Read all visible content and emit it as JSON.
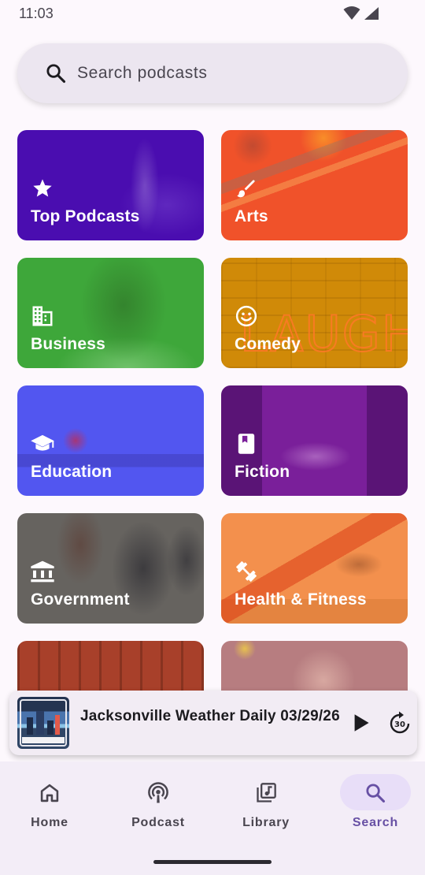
{
  "status_bar": {
    "time": "11:03"
  },
  "search": {
    "placeholder": "Search podcasts"
  },
  "categories": [
    {
      "label": "Top Podcasts",
      "icon": "star-icon",
      "color": "#4A0DB0"
    },
    {
      "label": "Arts",
      "icon": "brush-icon",
      "color": "#F0522A"
    },
    {
      "label": "Business",
      "icon": "building-icon",
      "color": "#3EA73A"
    },
    {
      "label": "Comedy",
      "icon": "smiley-icon",
      "color": "#D08A08"
    },
    {
      "label": "Education",
      "icon": "school-icon",
      "color": "#5256F0"
    },
    {
      "label": "Fiction",
      "icon": "book-icon",
      "color": "#7A1F9A"
    },
    {
      "label": "Government",
      "icon": "bank-icon",
      "color": "#66635F"
    },
    {
      "label": "Health & Fitness",
      "icon": "dumbbell-icon",
      "color": "#F3904D"
    },
    {
      "label": "",
      "icon": "",
      "color": "#A8402A"
    },
    {
      "label": "",
      "icon": "",
      "color": "#B77D80"
    }
  ],
  "mini_player": {
    "title": "Jacksonville Weather Daily 03/29/26",
    "art_icon": "podcast-artwork",
    "play_icon": "play-icon",
    "forward_icon": "forward-30-icon",
    "forward_seconds": "30"
  },
  "bottom_nav": {
    "items": [
      {
        "label": "Home",
        "icon": "home-icon"
      },
      {
        "label": "Podcast",
        "icon": "podcast-icon"
      },
      {
        "label": "Library",
        "icon": "library-icon"
      },
      {
        "label": "Search",
        "icon": "search-icon",
        "active": true
      }
    ]
  },
  "colors": {
    "accent": "#6750A4",
    "active_pill": "#E8DEF8",
    "nav_background": "#F3EDF7"
  }
}
